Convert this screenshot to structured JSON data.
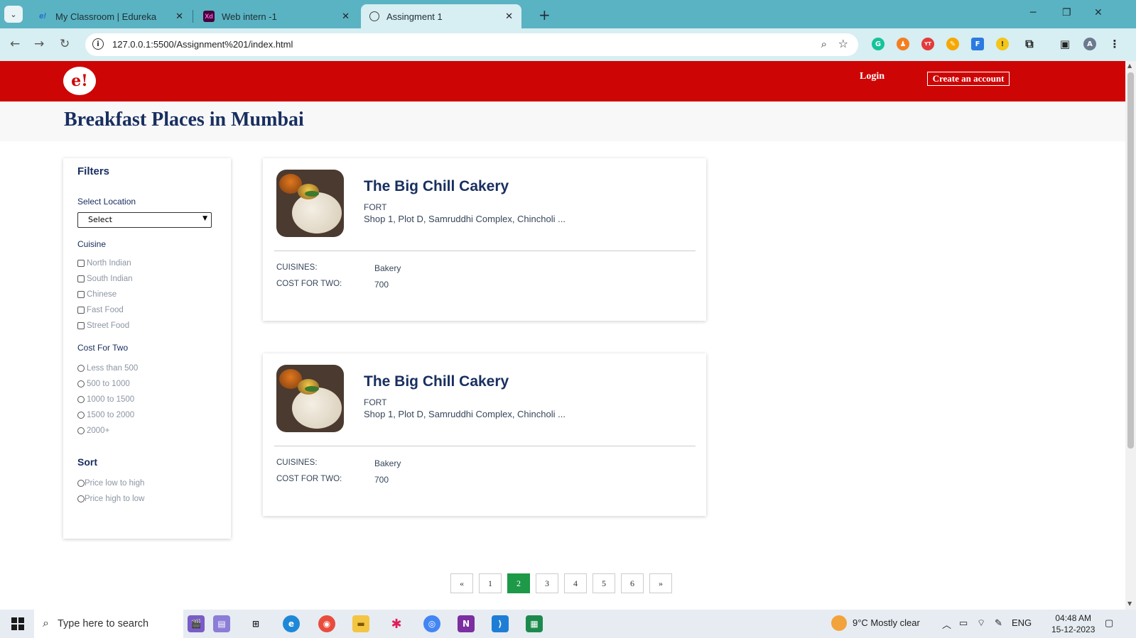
{
  "browser": {
    "tabs": [
      {
        "label": "My Classroom | Edureka",
        "favicon": "e!"
      },
      {
        "label": "Web intern -1",
        "favicon": "Xd"
      },
      {
        "label": "Assingment 1",
        "favicon": "globe"
      }
    ],
    "url": "127.0.0.1:5500/Assignment%201/index.html"
  },
  "header": {
    "logo": "e!",
    "login": "Login",
    "create_account": "Create an account"
  },
  "page_title": "Breakfast Places in Mumbai",
  "filters": {
    "title": "Filters",
    "location_label": "Select Location",
    "location_selected": "Select",
    "cuisine_label": "Cuisine",
    "cuisines": [
      "North Indian",
      "South Indian",
      "Chinese",
      "Fast Food",
      "Street Food"
    ],
    "cost_label": "Cost For Two",
    "costs": [
      "Less than 500",
      "500 to 1000",
      "1000 to 1500",
      "1500 to 2000",
      "2000+"
    ],
    "sort_label": "Sort",
    "sorts": [
      "Price low to high",
      "Price high to low"
    ]
  },
  "results": [
    {
      "name": "The Big Chill Cakery",
      "locality": "FORT",
      "address": "Shop 1, Plot D, Samruddhi Complex, Chincholi ...",
      "cuisines_label": "CUISINES:",
      "cuisines": "Bakery",
      "cost_label": "COST FOR TWO:",
      "cost": "700"
    },
    {
      "name": "The Big Chill Cakery",
      "locality": "FORT",
      "address": "Shop 1, Plot D, Samruddhi Complex, Chincholi ...",
      "cuisines_label": "CUISINES:",
      "cuisines": "Bakery",
      "cost_label": "COST FOR TWO:",
      "cost": "700"
    }
  ],
  "pagination": {
    "prev": "«",
    "pages": [
      "1",
      "2",
      "3",
      "4",
      "5",
      "6"
    ],
    "active": "2",
    "next": "»"
  },
  "taskbar": {
    "search_placeholder": "Type here to search",
    "weather": "9°C  Mostly clear",
    "lang": "ENG",
    "time": "04:48 AM",
    "date": "15-12-2023"
  },
  "colors": {
    "header_red": "#ce0505",
    "title_navy": "#192f60",
    "active_page_green": "#1d9948",
    "chrome_teal": "#5ab3c2"
  }
}
